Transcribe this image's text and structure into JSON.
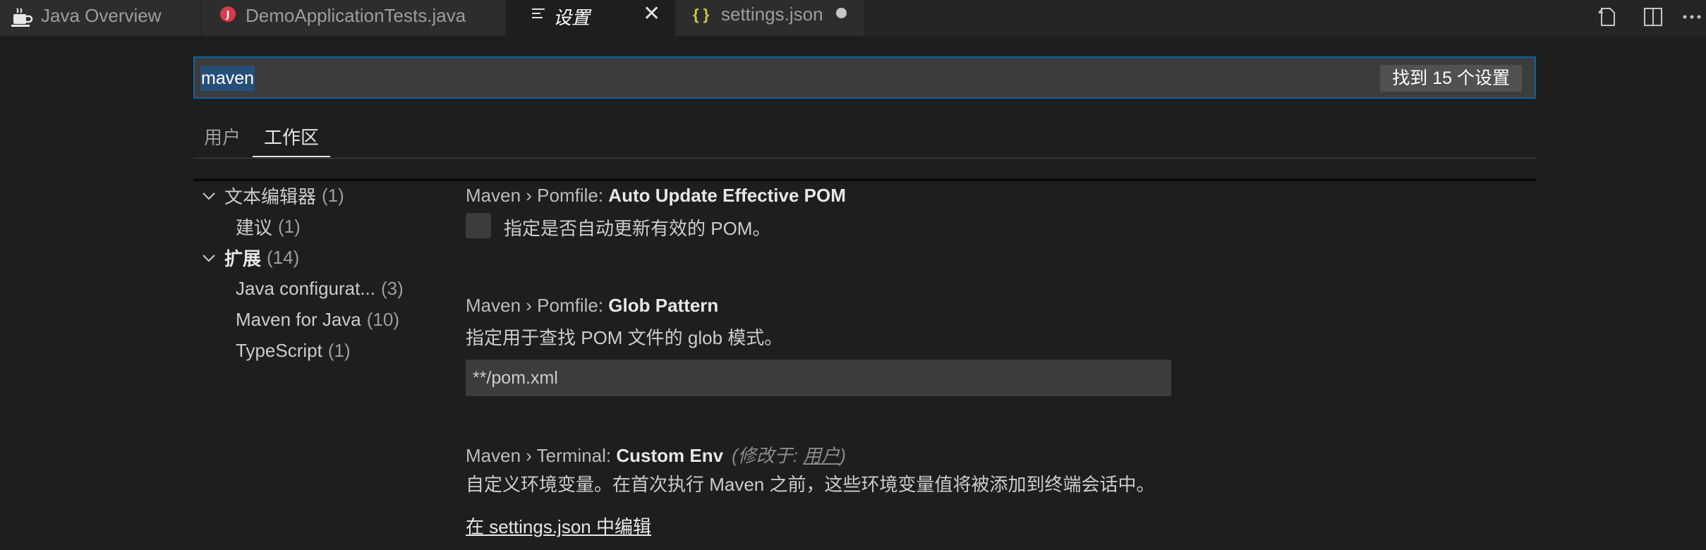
{
  "tabs": [
    {
      "label": "Java Overview",
      "icon": "java-cup-icon"
    },
    {
      "label": "DemoApplicationTests.java",
      "icon": "java-file-icon"
    },
    {
      "label": "设置",
      "icon": "settings-lines-icon",
      "close": "✕"
    },
    {
      "label": "settings.json",
      "icon": "json-braces-icon",
      "braces": "{ }"
    }
  ],
  "editor_actions": [
    "open-settings-json-icon",
    "split-editor-icon",
    "more-actions-icon"
  ],
  "search": {
    "value": "maven",
    "result_count": "找到 15 个设置"
  },
  "scope_tabs": [
    {
      "label": "用户"
    },
    {
      "label": "工作区"
    }
  ],
  "toc": {
    "items": [
      {
        "label": "文本编辑器",
        "count": "(1)"
      },
      {
        "label": "建议",
        "count": "(1)"
      },
      {
        "label": "扩展",
        "count": "(14)"
      },
      {
        "label": "Java configurat...",
        "count": "(3)"
      },
      {
        "label": "Maven for Java",
        "count": "(10)"
      },
      {
        "label": "TypeScript",
        "count": "(1)"
      }
    ]
  },
  "settings": [
    {
      "category": "Maven › Pomfile: ",
      "key": "Auto Update Effective POM",
      "description": "指定是否自动更新有效的 POM。",
      "checked": false
    },
    {
      "category": "Maven › Pomfile: ",
      "key": "Glob Pattern",
      "description": "指定用于查找 POM 文件的 glob 模式。",
      "value": "**/pom.xml"
    },
    {
      "category": "Maven › Terminal: ",
      "key": "Custom Env",
      "modified_prefix": "(修改于: ",
      "modified_link": "用户",
      "modified_suffix": ")",
      "description": "自定义环境变量。在首次执行 Maven 之前，这些环境变量值将被添加到终端会话中。",
      "link": "在 settings.json 中编辑"
    }
  ],
  "colors": {
    "accent_border": "#0e639c",
    "selection": "#264f78",
    "java_red": "#d73a49",
    "json_yellow": "#cbcb41"
  }
}
